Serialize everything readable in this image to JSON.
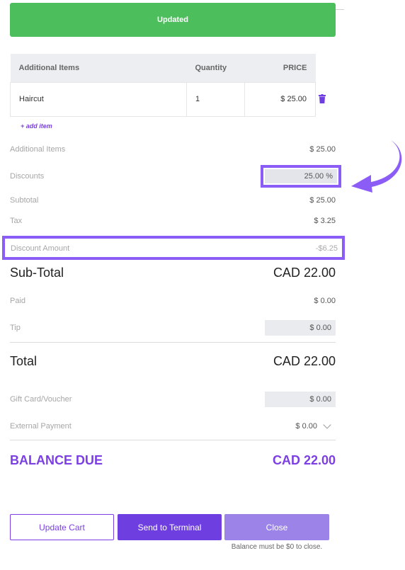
{
  "banner": {
    "text": "Updated"
  },
  "table": {
    "headers": [
      "Additional Items",
      "Quantity",
      "PRICE"
    ],
    "rows": [
      {
        "item": "Haircut",
        "quantity": "1",
        "price": "$ 25.00"
      }
    ],
    "add_item": "+ add item"
  },
  "summary": {
    "additional_items_label": "Additional Items",
    "additional_items_value": "$ 25.00",
    "discounts_label": "Discounts",
    "discounts_value": "25.00 %",
    "subtotal_label": "Subtotal",
    "subtotal_value": "$ 25.00",
    "tax_label": "Tax",
    "tax_value": "$ 3.25",
    "discount_amount_label": "Discount Amount",
    "discount_amount_value": "-$6.25",
    "sub_total_label": "Sub-Total",
    "sub_total_value": "CAD 22.00",
    "paid_label": "Paid",
    "paid_value": "$ 0.00",
    "tip_label": "Tip",
    "tip_value": "$ 0.00",
    "total_label": "Total",
    "total_value": "CAD 22.00",
    "gift_card_label": "Gift Card/Voucher",
    "gift_card_value": "$ 0.00",
    "external_payment_label": "External Payment",
    "external_payment_value": "$ 0.00",
    "balance_due_label": "BALANCE DUE",
    "balance_due_value": "CAD 22.00"
  },
  "buttons": {
    "update_cart": "Update Cart",
    "send_to_terminal": "Send to Terminal",
    "close": "Close"
  },
  "note": "Balance must be $0 to close.",
  "colors": {
    "accent": "#7b3fe4",
    "success": "#4cbe5b",
    "highlight": "#8b5cf6"
  },
  "icons": {
    "delete": "trash-icon",
    "dropdown": "chevron-down-icon",
    "annotation": "curved-arrow-icon"
  }
}
